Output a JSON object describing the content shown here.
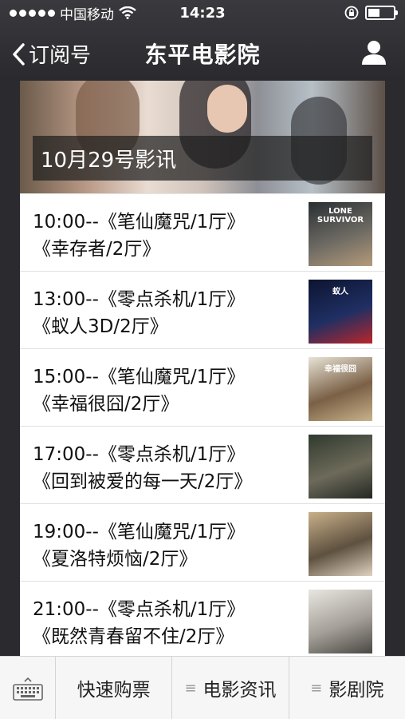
{
  "status_bar": {
    "carrier": "中国移动",
    "time": "14:23"
  },
  "nav": {
    "back_label": "订阅号",
    "title": "东平电影院"
  },
  "banner": {
    "caption": "10月29号影讯"
  },
  "schedule": [
    {
      "line1": "10:00--《笔仙魔咒/1厅》",
      "line2": "《幸存者/2厅》",
      "poster_text": "LONE SURVIVOR",
      "poster_colors": [
        "#2a2f33",
        "#6d6a63",
        "#b49a7a"
      ]
    },
    {
      "line1": "13:00--《零点杀机/1厅》",
      "line2": "《蚁人3D/2厅》",
      "poster_text": "蚁人",
      "poster_colors": [
        "#0d1430",
        "#1f2f63",
        "#b9262a"
      ]
    },
    {
      "line1": "15:00--《笔仙魔咒/1厅》",
      "line2": "《幸福很囧/2厅》",
      "poster_text": "幸福很囧",
      "poster_colors": [
        "#e8e3d6",
        "#7a6046",
        "#c8b28a"
      ]
    },
    {
      "line1": "17:00--《零点杀机/1厅》",
      "line2": "《回到被爱的每一天/2厅》",
      "poster_text": "",
      "poster_colors": [
        "#2f3a2e",
        "#6d6a5a",
        "#232822"
      ]
    },
    {
      "line1": "19:00--《笔仙魔咒/1厅》",
      "line2": "《夏洛特烦恼/2厅》",
      "poster_text": "",
      "poster_colors": [
        "#c9b089",
        "#5e5140",
        "#e0d2bf"
      ]
    },
    {
      "line1": "21:00--《零点杀机/1厅》",
      "line2": "《既然青春留不住/2厅》",
      "poster_text": "",
      "poster_colors": [
        "#e9e6e1",
        "#a49f98",
        "#4a4743"
      ]
    }
  ],
  "bottom_menu": {
    "items": [
      "快速购票",
      "电影资讯",
      "影剧院"
    ]
  }
}
